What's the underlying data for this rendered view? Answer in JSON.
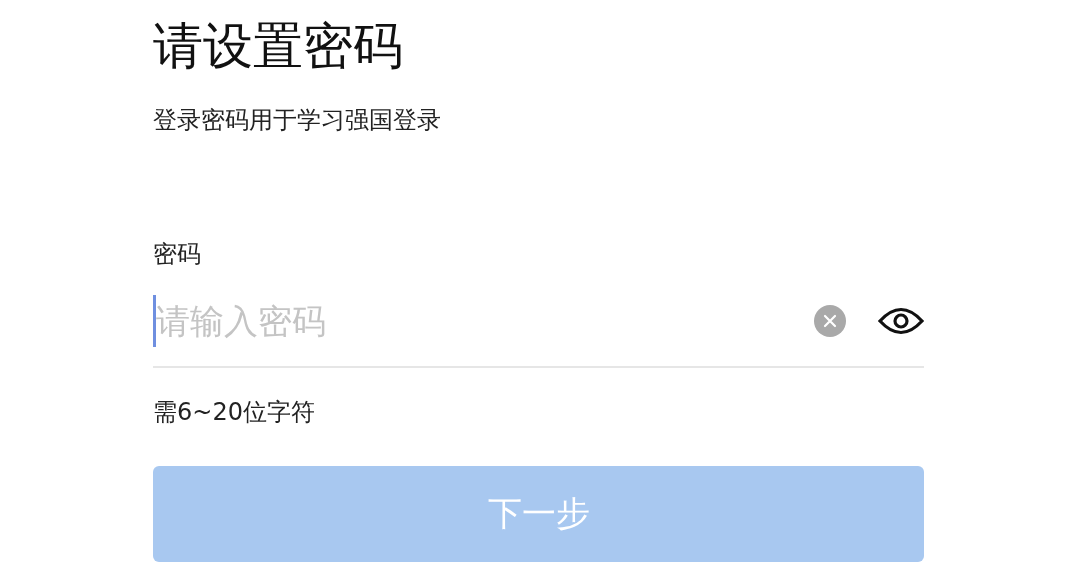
{
  "title": "请设置密码",
  "subtitle": "登录密码用于学习强国登录",
  "password_field": {
    "label": "密码",
    "placeholder": "请输入密码"
  },
  "hint": "需6~20位字符",
  "next_button": {
    "label": "下一步",
    "disabled": true
  }
}
